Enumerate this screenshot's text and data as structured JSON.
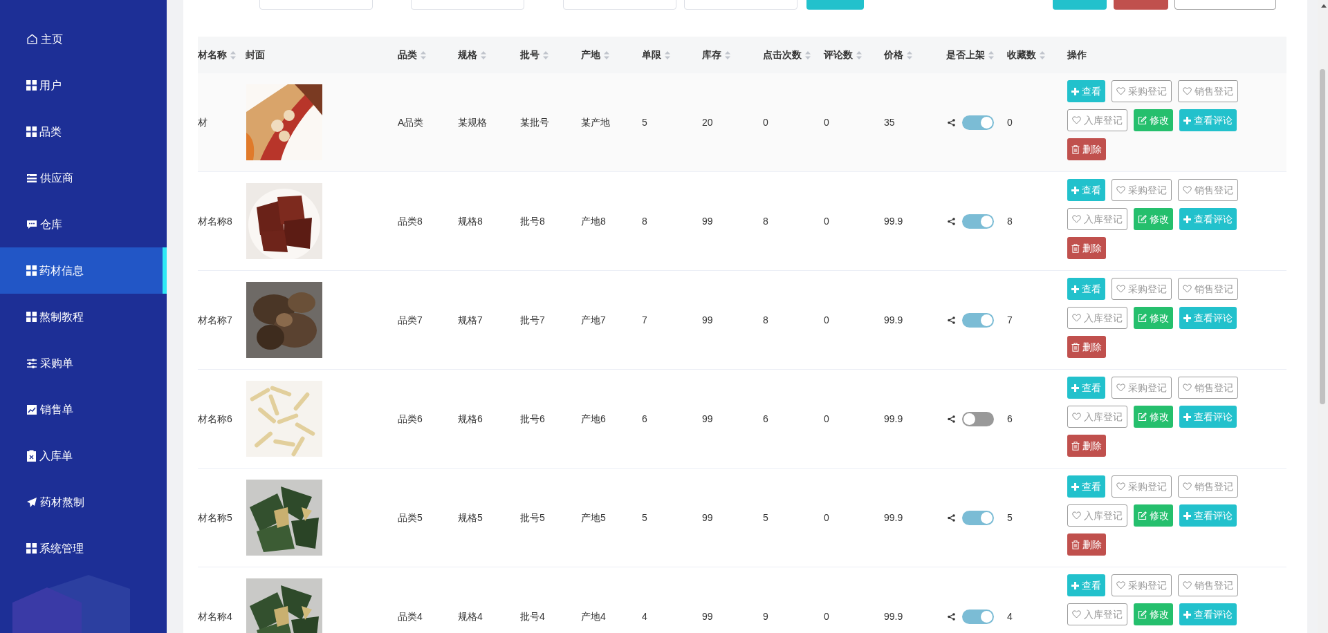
{
  "sidebar": {
    "items": [
      {
        "label": "主页",
        "selected": false
      },
      {
        "label": "用户",
        "selected": false
      },
      {
        "label": "品类",
        "selected": false
      },
      {
        "label": "供应商",
        "selected": false
      },
      {
        "label": "仓库",
        "selected": false
      },
      {
        "label": "药材信息",
        "selected": true
      },
      {
        "label": "熬制教程",
        "selected": false
      },
      {
        "label": "采购单",
        "selected": false
      },
      {
        "label": "销售单",
        "selected": false
      },
      {
        "label": "入库单",
        "selected": false
      },
      {
        "label": "药材熬制",
        "selected": false
      },
      {
        "label": "系统管理",
        "selected": false
      }
    ]
  },
  "table": {
    "columns": [
      {
        "label": "材名称",
        "sortable": true
      },
      {
        "label": "封面",
        "sortable": false
      },
      {
        "label": "品类",
        "sortable": true
      },
      {
        "label": "规格",
        "sortable": true
      },
      {
        "label": "批号",
        "sortable": true
      },
      {
        "label": "产地",
        "sortable": true
      },
      {
        "label": "单限",
        "sortable": true
      },
      {
        "label": "库存",
        "sortable": true
      },
      {
        "label": "点击次数",
        "sortable": true
      },
      {
        "label": "评论数",
        "sortable": true
      },
      {
        "label": "价格",
        "sortable": true
      },
      {
        "label": "是否上架",
        "sortable": true
      },
      {
        "label": "收藏数",
        "sortable": true
      },
      {
        "label": "操作",
        "sortable": false
      }
    ],
    "rows": [
      {
        "cells": [
          "材",
          "",
          "A品类",
          "某规格",
          "某批号",
          "某产地",
          "5",
          "20",
          "0",
          "0",
          "35",
          "",
          "0"
        ],
        "on": true,
        "actions": [
          {
            "label": "查看",
            "kind": "view"
          },
          {
            "label": "采购登记",
            "kind": "register"
          },
          {
            "label": "销售登记",
            "kind": "register"
          },
          {
            "label": "入库登记",
            "kind": "register"
          },
          {
            "label": "修改",
            "kind": "edit"
          },
          {
            "label": "查看评论",
            "kind": "view"
          },
          {
            "label": "删除",
            "kind": "delete"
          }
        ]
      },
      {
        "cells": [
          "材名称8",
          "",
          "品类8",
          "规格8",
          "批号8",
          "产地8",
          "8",
          "99",
          "8",
          "0",
          "99.9",
          "",
          "8"
        ],
        "on": true,
        "actions": [
          {
            "label": "查看",
            "kind": "view"
          },
          {
            "label": "采购登记",
            "kind": "register"
          },
          {
            "label": "销售登记",
            "kind": "register"
          },
          {
            "label": "入库登记",
            "kind": "register"
          },
          {
            "label": "修改",
            "kind": "edit"
          },
          {
            "label": "查看评论",
            "kind": "view"
          },
          {
            "label": "删除",
            "kind": "delete"
          }
        ]
      },
      {
        "cells": [
          "材名称7",
          "",
          "品类7",
          "规格7",
          "批号7",
          "产地7",
          "7",
          "99",
          "8",
          "0",
          "99.9",
          "",
          "7"
        ],
        "on": true,
        "actions": [
          {
            "label": "查看",
            "kind": "view"
          },
          {
            "label": "采购登记",
            "kind": "register"
          },
          {
            "label": "销售登记",
            "kind": "register"
          },
          {
            "label": "入库登记",
            "kind": "register"
          },
          {
            "label": "修改",
            "kind": "edit"
          },
          {
            "label": "查看评论",
            "kind": "view"
          },
          {
            "label": "删除",
            "kind": "delete"
          }
        ]
      },
      {
        "cells": [
          "材名称6",
          "",
          "品类6",
          "规格6",
          "批号6",
          "产地6",
          "6",
          "99",
          "6",
          "0",
          "99.9",
          "",
          "6"
        ],
        "on": false,
        "actions": [
          {
            "label": "查看",
            "kind": "view"
          },
          {
            "label": "采购登记",
            "kind": "register"
          },
          {
            "label": "销售登记",
            "kind": "register"
          },
          {
            "label": "入库登记",
            "kind": "register"
          },
          {
            "label": "修改",
            "kind": "edit"
          },
          {
            "label": "查看评论",
            "kind": "view"
          },
          {
            "label": "删除",
            "kind": "delete"
          }
        ]
      },
      {
        "cells": [
          "材名称5",
          "",
          "品类5",
          "规格5",
          "批号5",
          "产地5",
          "5",
          "99",
          "5",
          "0",
          "99.9",
          "",
          "5"
        ],
        "on": true,
        "actions": [
          {
            "label": "查看",
            "kind": "view"
          },
          {
            "label": "采购登记",
            "kind": "register"
          },
          {
            "label": "销售登记",
            "kind": "register"
          },
          {
            "label": "入库登记",
            "kind": "register"
          },
          {
            "label": "修改",
            "kind": "edit"
          },
          {
            "label": "查看评论",
            "kind": "view"
          },
          {
            "label": "删除",
            "kind": "delete"
          }
        ]
      },
      {
        "cells": [
          "材名称4",
          "",
          "品类4",
          "规格4",
          "批号4",
          "产地4",
          "4",
          "99",
          "9",
          "0",
          "99.9",
          "",
          "4"
        ],
        "on": true,
        "actions": [
          {
            "label": "查看",
            "kind": "view"
          },
          {
            "label": "采购登记",
            "kind": "register"
          },
          {
            "label": "销售登记",
            "kind": "register"
          },
          {
            "label": "入库登记",
            "kind": "register"
          },
          {
            "label": "修改",
            "kind": "edit"
          },
          {
            "label": "查看评论",
            "kind": "view"
          }
        ]
      }
    ]
  }
}
